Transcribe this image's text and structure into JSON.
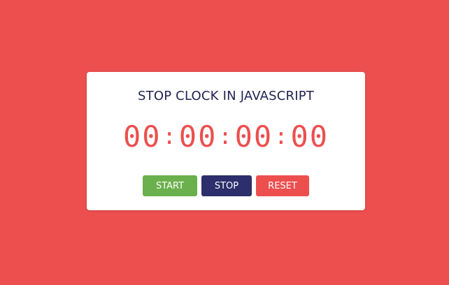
{
  "stopclock": {
    "title": "STOP CLOCK IN JAVASCRIPT",
    "display": {
      "segments": [
        "00",
        "00",
        "00",
        "00"
      ],
      "separator": ":"
    },
    "buttons": {
      "start": {
        "label": "START",
        "color": "#6ab04c"
      },
      "stop": {
        "label": "STOP",
        "color": "#2c2f6b"
      },
      "reset": {
        "label": "RESET",
        "color": "#ec4f4e"
      }
    }
  },
  "colors": {
    "background": "#ec4f4e",
    "card": "#ffffff",
    "digits": "#ec4f4e",
    "title": "#1f2250"
  }
}
